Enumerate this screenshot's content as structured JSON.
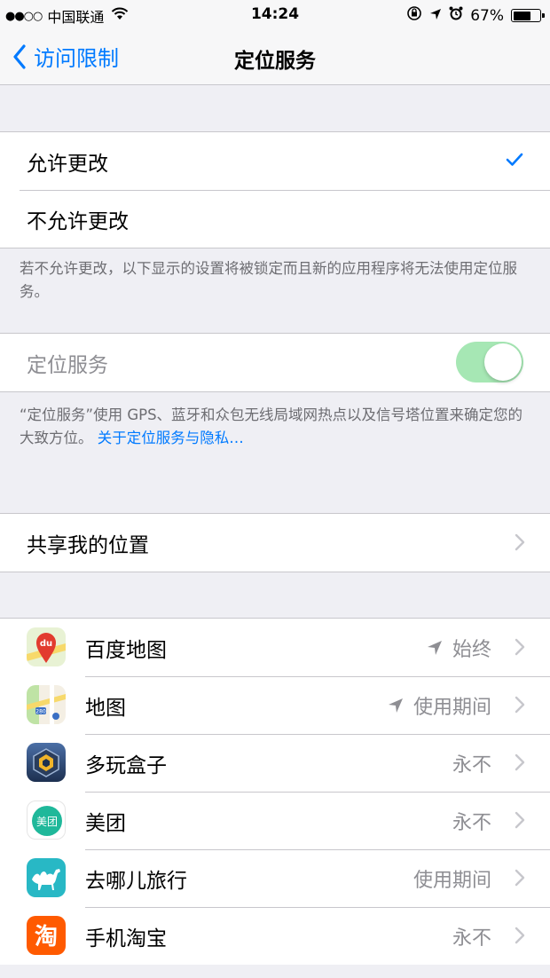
{
  "statusbar": {
    "signal": "●●○○",
    "carrier": "中国联通",
    "time": "14:24",
    "battery": "67%",
    "battery_level": 0.67
  },
  "nav": {
    "back_label": "访问限制",
    "title": "定位服务"
  },
  "allow_group": {
    "allow": "允许更改",
    "disallow": "不允许更改",
    "selected": "allow",
    "footnote": "若不允许更改，以下显示的设置将被锁定而且新的应用程序将无法使用定位服务。"
  },
  "location": {
    "label": "定位服务",
    "enabled": true,
    "footnote_text": "“定位服务”使用 GPS、蓝牙和众包无线局域网热点以及信号塔位置来确定您的大致方位。",
    "footnote_link": "关于定位服务与隐私…"
  },
  "share": {
    "label": "共享我的位置"
  },
  "apps": [
    {
      "name": "百度地图",
      "status": "始终",
      "arrow": true,
      "icon": "baidu-map-icon"
    },
    {
      "name": "地图",
      "status": "使用期间",
      "arrow": true,
      "icon": "apple-maps-icon"
    },
    {
      "name": "多玩盒子",
      "status": "永不",
      "arrow": false,
      "icon": "duowan-box-icon"
    },
    {
      "name": "美团",
      "status": "永不",
      "arrow": false,
      "icon": "meituan-icon",
      "icon_text": "美团"
    },
    {
      "name": "去哪儿旅行",
      "status": "使用期间",
      "arrow": false,
      "icon": "qunar-camel-icon"
    },
    {
      "name": "手机淘宝",
      "status": "永不",
      "arrow": false,
      "icon": "taobao-icon",
      "icon_text": "淘"
    }
  ],
  "colors": {
    "accent": "#007aff",
    "toggle_on_dim": "#a6e7b4",
    "background": "#efeff4"
  }
}
